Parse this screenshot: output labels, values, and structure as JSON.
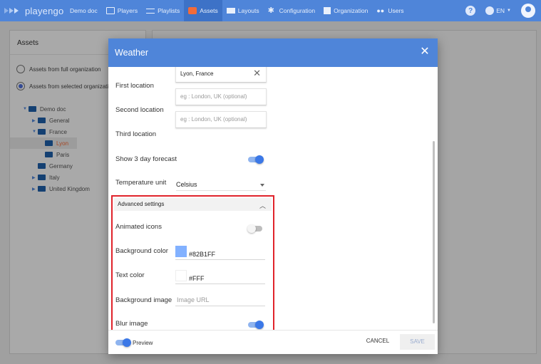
{
  "nav": {
    "brand": "playengo",
    "items": [
      {
        "label": "Demo doc",
        "icon": "none"
      },
      {
        "label": "Players",
        "icon": "monitor-icon"
      },
      {
        "label": "Playlists",
        "icon": "playlist-icon"
      },
      {
        "label": "Assets",
        "icon": "assets-icon",
        "active": true
      },
      {
        "label": "Layouts",
        "icon": "layouts-icon"
      },
      {
        "label": "Configuration",
        "icon": "gear-icon"
      },
      {
        "label": "Organization",
        "icon": "building-icon"
      },
      {
        "label": "Users",
        "icon": "users-icon"
      }
    ],
    "help": "?",
    "lang": "EN"
  },
  "assets_panel": {
    "title": "Assets",
    "radio_full": "Assets from full organization",
    "radio_selected": "Assets from selected organizati",
    "tree": {
      "root": "Demo doc",
      "general": "General",
      "france": "France",
      "lyon": "Lyon",
      "paris": "Paris",
      "germany": "Germany",
      "italy": "Italy",
      "uk": "United Kingdom"
    }
  },
  "dialog": {
    "title": "Weather",
    "first_location": {
      "label": "First location",
      "value": "Lyon, France"
    },
    "second_location": {
      "label": "Second location",
      "placeholder": "eg : London, UK (optional)"
    },
    "third_location": {
      "label": "Third location",
      "placeholder": "eg : London, UK (optional)"
    },
    "forecast": {
      "label": "Show 3 day forecast",
      "on": true
    },
    "temperature": {
      "label": "Temperature unit",
      "value": "Celsius"
    },
    "advanced": {
      "title": "Advanced settings",
      "animated_icons": {
        "label": "Animated icons",
        "on": false
      },
      "background_color": {
        "label": "Background color",
        "value": "#82B1FF",
        "swatch": "#82B1FF"
      },
      "text_color": {
        "label": "Text color",
        "value": "#FFF",
        "swatch": "#FFFFFF"
      },
      "background_image": {
        "label": "Background image",
        "placeholder": "Image URL"
      },
      "blur_image": {
        "label": "Blur image",
        "on": true
      }
    },
    "footer": {
      "preview_label": "Preview",
      "cancel": "CANCEL",
      "save": "SAVE"
    }
  },
  "colors": {
    "accent": "#4F85D9",
    "highlight_border": "#E0232B",
    "active_tab": "#F26B3A"
  }
}
